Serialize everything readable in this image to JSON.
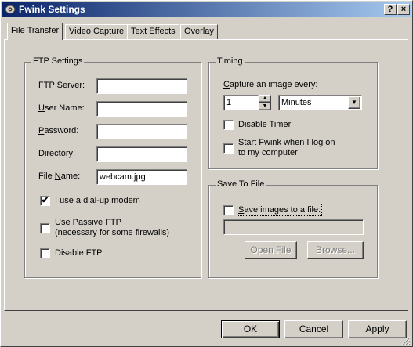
{
  "window": {
    "title": "Fwink Settings",
    "help_label": "?",
    "close_label": "×"
  },
  "tabs": [
    {
      "label": "File Transfer"
    },
    {
      "label": "Video Capture"
    },
    {
      "label": "Text Effects"
    },
    {
      "label": "Overlay"
    }
  ],
  "ftp": {
    "title": "FTP Settings",
    "server": {
      "label_pre": "FTP ",
      "label_u": "S",
      "label_post": "erver:",
      "value": ""
    },
    "user": {
      "label_pre": "",
      "label_u": "U",
      "label_post": "ser Name:",
      "value": ""
    },
    "password": {
      "label_pre": "",
      "label_u": "P",
      "label_post": "assword:",
      "value": ""
    },
    "directory": {
      "label_pre": "",
      "label_u": "D",
      "label_post": "irectory:",
      "value": ""
    },
    "filename": {
      "label_pre": "File ",
      "label_u": "N",
      "label_post": "ame:",
      "value": "webcam.jpg"
    },
    "dialup": {
      "label_pre": "I use a dial-up ",
      "label_u": "m",
      "label_post": "odem",
      "checked": true
    },
    "passive": {
      "label_pre": "Use ",
      "label_u": "P",
      "label_post": "assive FTP",
      "label2": "(necessary for some firewalls)",
      "checked": false
    },
    "disable": {
      "label": "Disable FTP",
      "checked": false
    }
  },
  "timing": {
    "title": "Timing",
    "capture_label_u": "C",
    "capture_label_post": "apture an image every:",
    "interval_value": "1",
    "unit_value": "Minutes",
    "disable_timer": {
      "label": "Disable Timer",
      "checked": false
    },
    "start_on_logon": {
      "label1": "Start Fwink when I log on",
      "label2": "to my computer",
      "checked": false
    }
  },
  "save": {
    "title": "Save To File",
    "save_images": {
      "label_u": "S",
      "label_post": "ave images to a file:",
      "checked": false
    },
    "path_value": "",
    "open_file_label": "Open File",
    "browse_label": "Browse..."
  },
  "footer": {
    "ok_label": "OK",
    "cancel_label": "Cancel",
    "apply_label": "Apply"
  }
}
